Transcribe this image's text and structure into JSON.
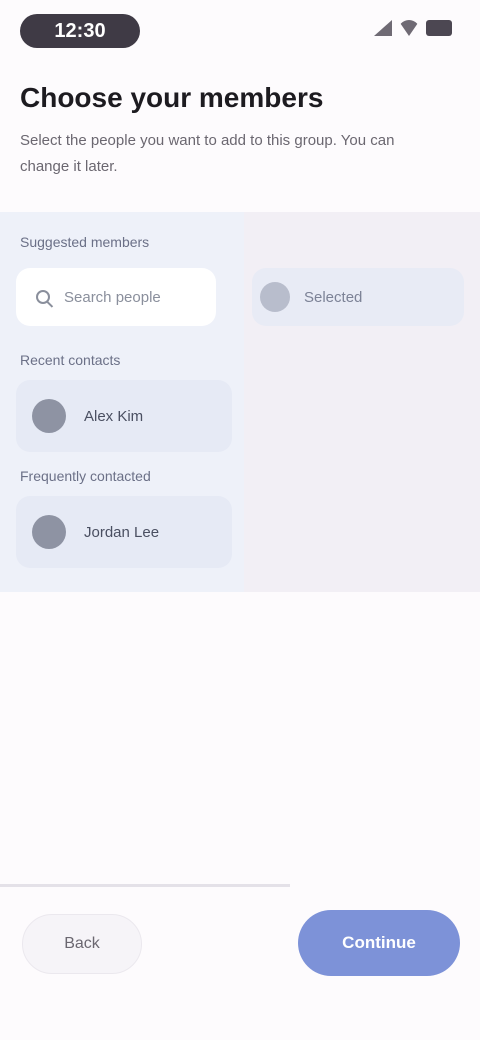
{
  "status_bar": {
    "time": "12:30"
  },
  "header": {
    "title": "Choose your members",
    "subtitle": "Select the people you want to add to this group. You can change it later."
  },
  "panel": {
    "section_label": "Suggested members",
    "search_placeholder": "Search people",
    "cards": [
      {
        "section": "Recent contacts",
        "name": "Alex Kim"
      },
      {
        "section": "Frequently contacted",
        "name": "Jordan Lee"
      }
    ],
    "selected": {
      "label": "Selected"
    }
  },
  "footer": {
    "back_label": "Back",
    "next_label": "Continue"
  },
  "colors": {
    "accent": "#7d92d8",
    "panel_bg": "#f2eff5",
    "left_column_bg": "#eef1f9"
  },
  "icons": [
    "signal-icon",
    "wifi-icon",
    "battery-icon",
    "search-icon"
  ]
}
